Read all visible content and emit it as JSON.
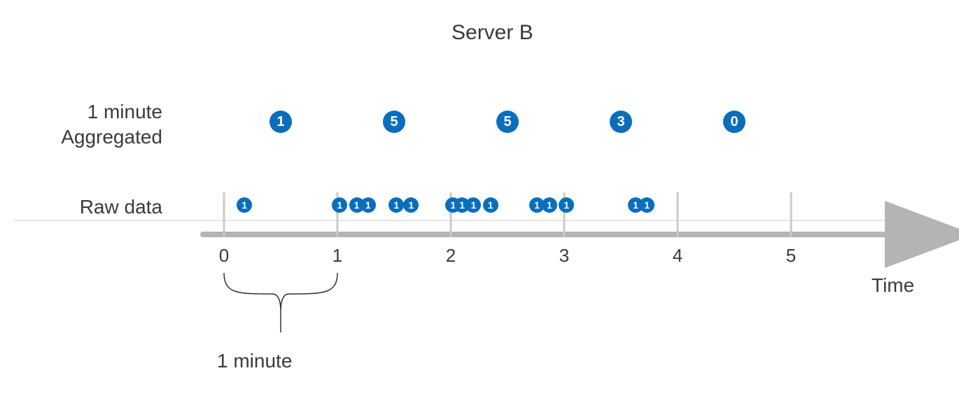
{
  "title": "Server B",
  "row_labels": {
    "aggregated_line1": "1 minute",
    "aggregated_line2": "Aggregated",
    "raw": "Raw data"
  },
  "axis": {
    "label": "Time",
    "ticks": [
      "0",
      "1",
      "2",
      "3",
      "4",
      "5"
    ]
  },
  "interval_label": "1 minute",
  "colors": {
    "circle": "#0a6ebd",
    "axis": "#b4b4b4"
  },
  "chart_data": {
    "type": "timeline",
    "x_unit": "minutes",
    "x_range": [
      0,
      5
    ],
    "aggregated": {
      "interval_minutes": 1,
      "buckets": [
        {
          "start": 0,
          "end": 1,
          "count": 1
        },
        {
          "start": 1,
          "end": 2,
          "count": 5
        },
        {
          "start": 2,
          "end": 3,
          "count": 5
        },
        {
          "start": 3,
          "end": 4,
          "count": 3
        },
        {
          "start": 4,
          "end": 5,
          "count": 0
        }
      ]
    },
    "raw_events": [
      {
        "t": 0.18,
        "value": 1
      },
      {
        "t": 1.02,
        "value": 1
      },
      {
        "t": 1.17,
        "value": 1
      },
      {
        "t": 1.27,
        "value": 1
      },
      {
        "t": 1.52,
        "value": 1
      },
      {
        "t": 1.65,
        "value": 1
      },
      {
        "t": 2.02,
        "value": 1
      },
      {
        "t": 2.1,
        "value": 1
      },
      {
        "t": 2.2,
        "value": 1
      },
      {
        "t": 2.35,
        "value": 1
      },
      {
        "t": 2.76,
        "value": 1
      },
      {
        "t": 2.87,
        "value": 1
      },
      {
        "t": 3.02,
        "value": 1
      },
      {
        "t": 3.63,
        "value": 1
      },
      {
        "t": 3.73,
        "value": 1
      }
    ]
  }
}
